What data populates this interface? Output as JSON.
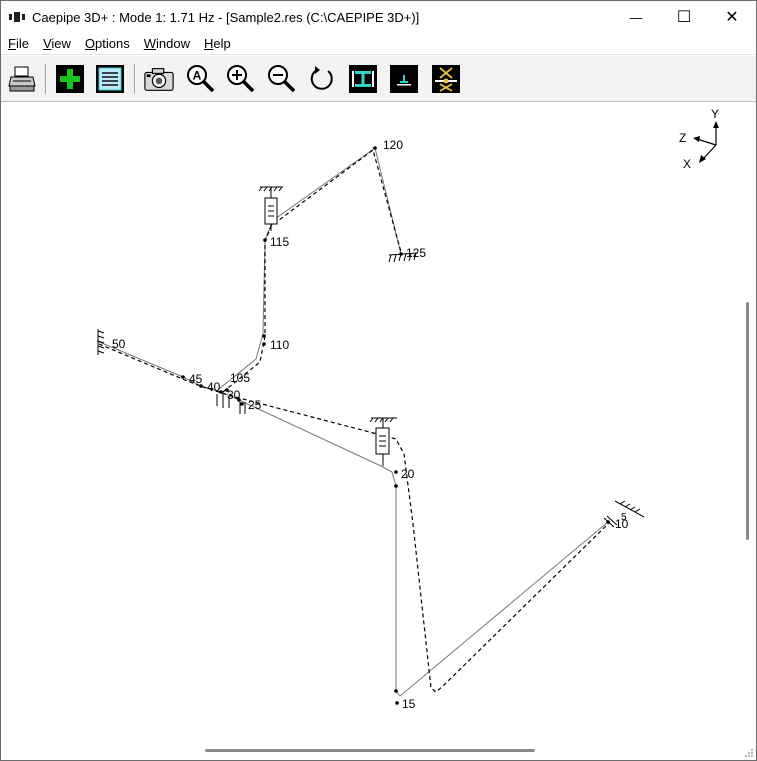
{
  "window": {
    "title": "Caepipe 3D+ : Mode 1: 1.71 Hz -  [Sample2.res (C:\\CAEPIPE 3D+)]",
    "controls": {
      "minimize": "—",
      "maximize": "☐",
      "close": "✕"
    }
  },
  "menu": {
    "items": [
      {
        "name": "file",
        "accel": "F",
        "rest": "ile"
      },
      {
        "name": "view",
        "accel": "V",
        "rest": "iew"
      },
      {
        "name": "options",
        "accel": "O",
        "rest": "ptions"
      },
      {
        "name": "window",
        "accel": "W",
        "rest": "indow"
      },
      {
        "name": "help",
        "accel": "H",
        "rest": "elp"
      }
    ]
  },
  "toolbar": {
    "buttons": [
      {
        "name": "print-button",
        "icon": "printer-icon"
      },
      {
        "name": "add-button",
        "icon": "plus-icon"
      },
      {
        "name": "list-button",
        "icon": "list-icon"
      },
      {
        "name": "snapshot-button",
        "icon": "camera-icon"
      },
      {
        "name": "zoom-all-button",
        "icon": "zoom-all-icon",
        "glyph": "A"
      },
      {
        "name": "zoom-in-button",
        "icon": "zoom-in-icon",
        "glyph": "+"
      },
      {
        "name": "zoom-out-button",
        "icon": "zoom-out-icon",
        "glyph": "−"
      },
      {
        "name": "rotate-button",
        "icon": "rotate-icon"
      },
      {
        "name": "show-beams-button",
        "icon": "beam-icon"
      },
      {
        "name": "show-supports-button",
        "icon": "support-icon"
      },
      {
        "name": "show-anchors-button",
        "icon": "anchor-icon"
      }
    ]
  },
  "axes": {
    "y": "Y",
    "z": "Z",
    "x": "X"
  },
  "nodes": {
    "n120": "120",
    "n125": "125",
    "n115": "115",
    "n110": "110",
    "n50": "50",
    "n45": "45",
    "n105": "105",
    "n40": "40",
    "n30": "30",
    "n25": "25",
    "n20": "20",
    "n10": "10",
    "n5": "5",
    "n15": "15"
  },
  "colors": {
    "toolbar_icon_bg": "#000000",
    "toolbar_icon_accent": "#2fd1c8",
    "plus_green": "#19c41c"
  }
}
